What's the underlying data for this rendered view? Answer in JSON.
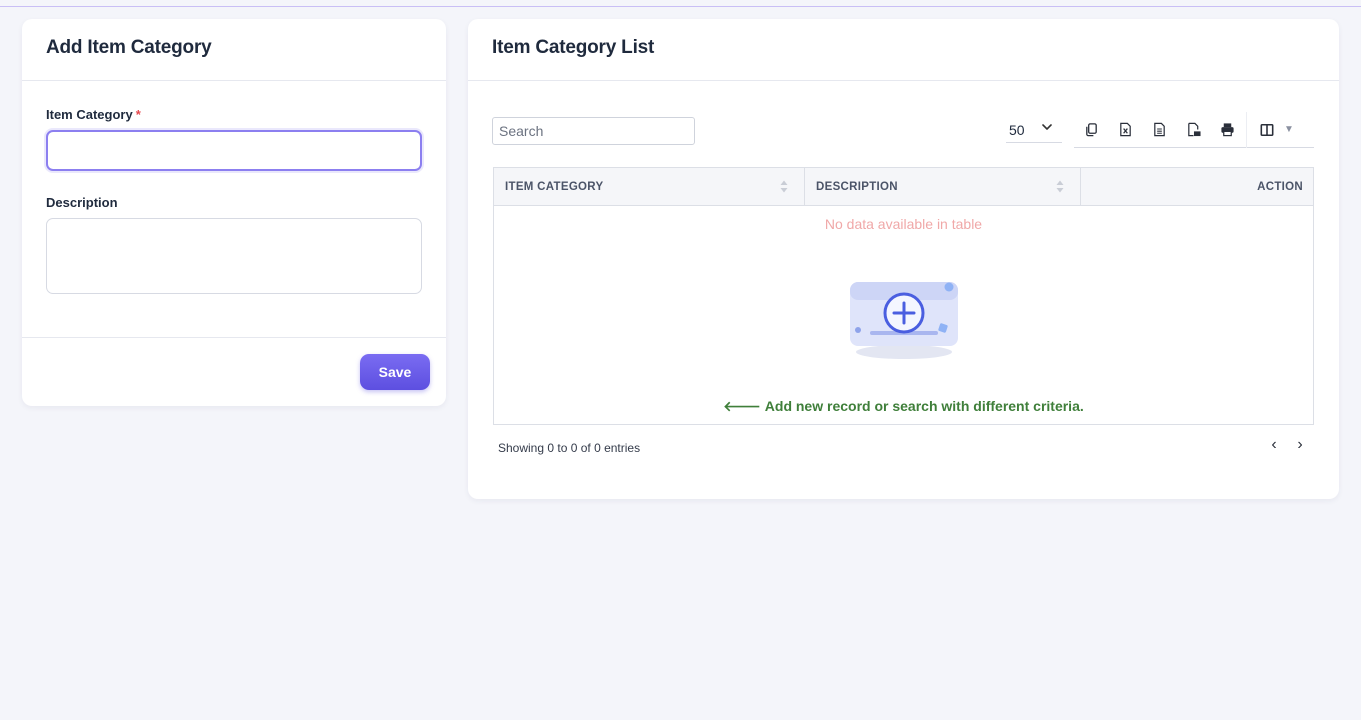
{
  "form": {
    "title": "Add Item Category",
    "item_category_label": "Item Category",
    "required_mark": "*",
    "item_category_value": "",
    "description_label": "Description",
    "description_value": "",
    "save_label": "Save"
  },
  "list": {
    "title": "Item Category List",
    "search_placeholder": "Search",
    "page_length": "50",
    "toolbar_icons": [
      "copy-icon",
      "excel-icon",
      "csv-icon",
      "pdf-icon",
      "print-icon",
      "columns-icon"
    ],
    "columns": [
      "ITEM CATEGORY",
      "DESCRIPTION",
      "ACTION"
    ],
    "empty_message": "No data available in table",
    "empty_hint": "Add new record or search with different criteria.",
    "info": "Showing 0 to 0 of 0 entries",
    "prev_label": "‹",
    "next_label": "›"
  },
  "colors": {
    "accent": "#6c5ce7",
    "focus_border": "#8c7ff0",
    "hint_green": "#3f7f3a",
    "empty_pink": "#f0a8a8",
    "page_bg": "#f4f5fa"
  }
}
